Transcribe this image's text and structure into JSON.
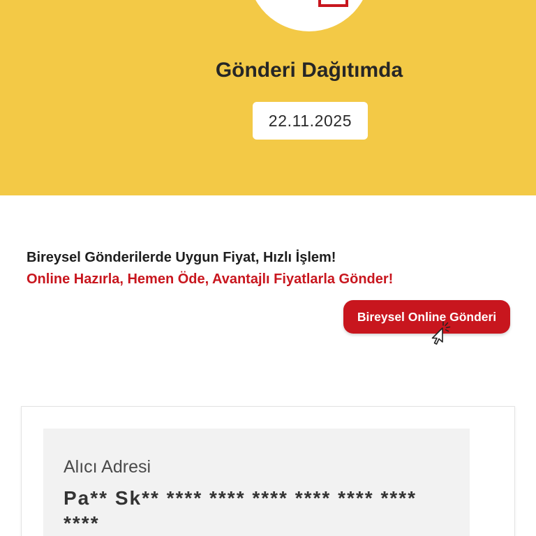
{
  "status": {
    "icon": "package-icon",
    "title": "Gönderi Dağıtımda",
    "date": "22.11.2025"
  },
  "promo": {
    "headline": "Bireysel Gönderilerde Uygun Fiyat, Hızlı İşlem!",
    "subheadline": "Online Hazırla, Hemen Öde, Avantajlı Fiyatlarla Gönder!",
    "button_label": "Bireysel Online Gönderi",
    "cursor_icon": "pointer-cursor-icon"
  },
  "recipient": {
    "label": "Alıcı Adresi",
    "address": "Pa** Sk** **** **** **** **** **** **** ****"
  },
  "colors": {
    "brand_yellow": "#F3C946",
    "brand_red": "#C8161E",
    "text_dark": "#222222",
    "panel_gray": "#F2F2F2"
  }
}
